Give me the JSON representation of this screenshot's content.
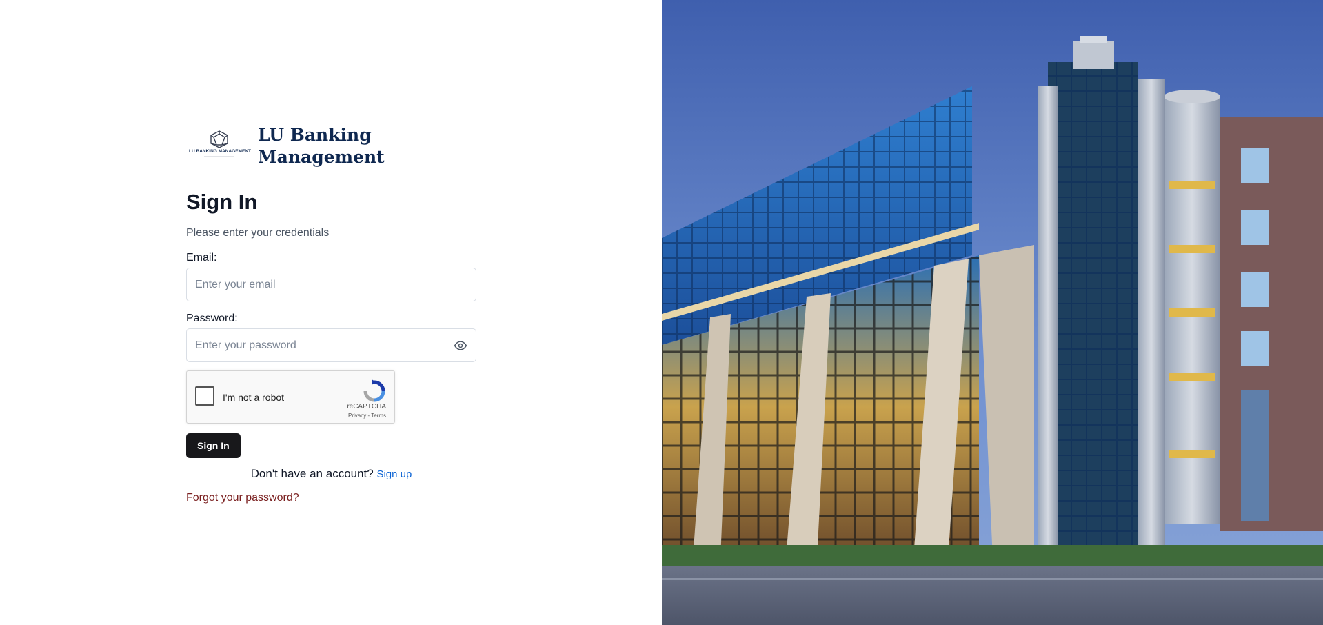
{
  "brand": {
    "logo_caption": "LU BANKING MANAGEMENT",
    "name_line1": "LU Banking",
    "name_line2": "Management"
  },
  "form": {
    "title": "Sign In",
    "subtitle": "Please enter your credentials",
    "email_label": "Email:",
    "email_placeholder": "Enter your email",
    "email_value": "",
    "password_label": "Password:",
    "password_placeholder": "Enter your password",
    "password_value": "",
    "password_toggle_icon": "eye-icon",
    "submit_label": "Sign In"
  },
  "captcha": {
    "label": "I'm not a robot",
    "brand": "reCAPTCHA",
    "links": "Privacy - Terms",
    "checked": false
  },
  "signup": {
    "prompt": "Don't have an account?",
    "link_label": "Sign up"
  },
  "forgot_password_label": "Forgot your password?",
  "colors": {
    "brand_navy": "#0f2850",
    "button_bg": "#18181b",
    "link_blue": "#0b63d4",
    "forgot_link": "#7a1f1f"
  },
  "hero_image": {
    "subject": "glass-office-building-at-dusk"
  }
}
